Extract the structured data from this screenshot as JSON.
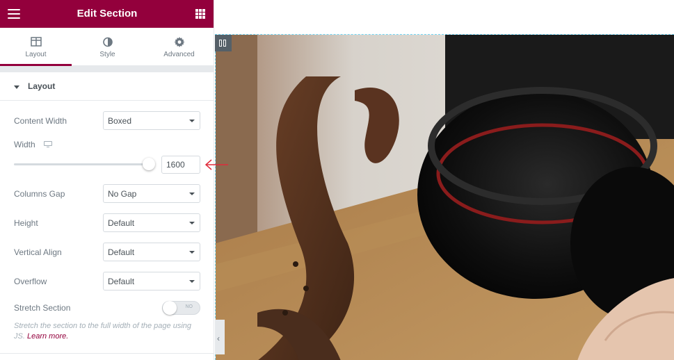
{
  "header": {
    "title": "Edit Section"
  },
  "tabs": [
    {
      "label": "Layout",
      "icon": "layout-icon",
      "active": true
    },
    {
      "label": "Style",
      "icon": "style-icon",
      "active": false
    },
    {
      "label": "Advanced",
      "icon": "gear-icon",
      "active": false
    }
  ],
  "section": {
    "title": "Layout"
  },
  "controls": {
    "content_width": {
      "label": "Content Width",
      "value": "Boxed"
    },
    "width": {
      "label": "Width",
      "value": "1600",
      "slider_fraction": 0.96,
      "device_icon": "desktop-icon"
    },
    "columns_gap": {
      "label": "Columns Gap",
      "value": "No Gap"
    },
    "height": {
      "label": "Height",
      "value": "Default"
    },
    "vertical_align": {
      "label": "Vertical Align",
      "value": "Default"
    },
    "overflow": {
      "label": "Overflow",
      "value": "Default"
    },
    "stretch_section": {
      "label": "Stretch Section",
      "toggle_text": "NO"
    }
  },
  "description": {
    "text": "Stretch the section to the full width of the page using JS.",
    "link": "Learn more."
  },
  "colors": {
    "brand": "#93003c",
    "accent_arrow": "#e02b3b",
    "section_outline": "#71d7f7"
  }
}
